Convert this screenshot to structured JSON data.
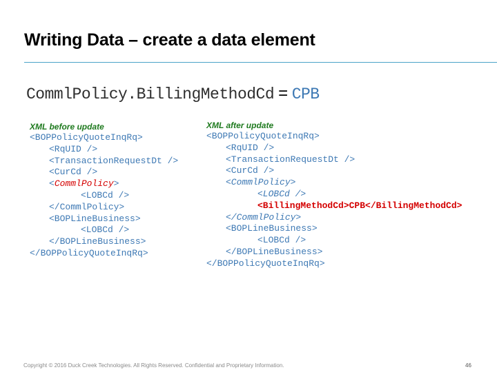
{
  "slide": {
    "title": "Writing Data – create a data element",
    "assignment": {
      "lhs": "CommlPolicy.BillingMethodCd",
      "eq": "=",
      "rhs": "CPB"
    },
    "before": {
      "heading": "XML before update",
      "lines": [
        "<BOPPolicyQuoteInqRq>",
        "<RqUID />",
        "<TransactionRequestDt />",
        "<CurCd />",
        "<",
        "CommlPolicy",
        ">",
        "<LOBCd />",
        "</CommlPolicy>",
        "<BOPLineBusiness>",
        "<LOBCd />",
        "</BOPLineBusiness>",
        "</BOPPolicyQuoteInqRq>"
      ]
    },
    "after": {
      "heading": "XML after update",
      "lines": [
        "<BOPPolicyQuoteInqRq>",
        "<RqUID />",
        "<TransactionRequestDt />",
        "<CurCd />",
        "<CommlPolicy>",
        "<LOBCd />",
        "<BillingMethodCd>CPB</BillingMethodCd>",
        "</CommlPolicy>",
        "<BOPLineBusiness>",
        "<LOBCd />",
        "</BOPLineBusiness>",
        "</BOPPolicyQuoteInqRq>"
      ]
    },
    "footer": "Copyright © 2016 Duck Creek Technologies. All Rights Reserved. Confidential and Proprietary Information.",
    "page_number": "46",
    "colors": {
      "code": "#3e79b4",
      "highlight": "#d40000",
      "heading": "#1f7a1f",
      "rule": "#4aa3c8"
    }
  }
}
